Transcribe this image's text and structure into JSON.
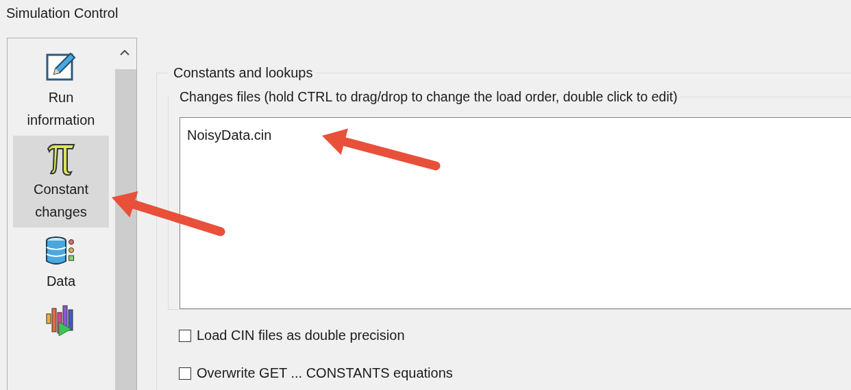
{
  "window": {
    "title": "Simulation Control"
  },
  "sidebar": {
    "items": [
      {
        "kind": "pencil",
        "label_lines": [
          "Run",
          "information"
        ],
        "selected": false
      },
      {
        "kind": "pi",
        "label_lines": [
          "Constant",
          "changes"
        ],
        "selected": true
      },
      {
        "kind": "database",
        "label_lines": [
          "Data"
        ],
        "selected": false
      },
      {
        "kind": "chart",
        "selected": false
      }
    ]
  },
  "group": {
    "title": "Constants and lookups",
    "changes_files": {
      "title": "Changes files (hold CTRL to drag/drop to change the load order, double click to edit)",
      "files": [
        "NoisyData.cin"
      ]
    },
    "options": [
      {
        "label": "Load CIN files as double precision",
        "checked": false
      },
      {
        "label": "Overwrite GET ... CONSTANTS equations",
        "checked": false
      }
    ]
  },
  "annotations": [
    {
      "kind": "arrow"
    },
    {
      "kind": "arrow"
    }
  ]
}
